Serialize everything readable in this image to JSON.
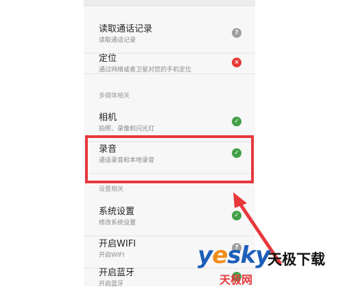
{
  "permissions": {
    "read_call_log": {
      "title": "读取通话记录",
      "subtitle": "读取通话记录",
      "status": "ask",
      "status_glyph": "?"
    },
    "location": {
      "title": "定位",
      "subtitle": "通过网络或者卫星对您的手机定位",
      "status": "deny",
      "status_glyph": "×"
    },
    "multimedia_section": "多媒体相关",
    "camera": {
      "title": "相机",
      "subtitle": "拍照、录像和闪光灯",
      "status": "allow",
      "status_glyph": "✓"
    },
    "recording": {
      "title": "录音",
      "subtitle": "通话录音和本地录音",
      "status": "allow",
      "status_glyph": "✓"
    },
    "settings_section": "设置相关",
    "system_settings": {
      "title": "系统设置",
      "subtitle": "修改系统设置",
      "status": "allow",
      "status_glyph": "✓"
    },
    "wifi": {
      "title": "开启WIFI",
      "subtitle": "开启WIFI",
      "status": "ask",
      "status_glyph": "?"
    },
    "bluetooth": {
      "title": "开启蓝牙",
      "subtitle": "开启蓝牙",
      "status": "allow",
      "status_glyph": "✓"
    }
  },
  "watermark": {
    "logo_part1": "y",
    "logo_part2": "e",
    "logo_part3": "sky",
    "cn_name": "天极下载",
    "cn_name2": "天极网"
  },
  "colors": {
    "highlight": "#e8383d",
    "allow": "#43a047",
    "deny": "#e53935",
    "ask": "#9e9e9e"
  }
}
